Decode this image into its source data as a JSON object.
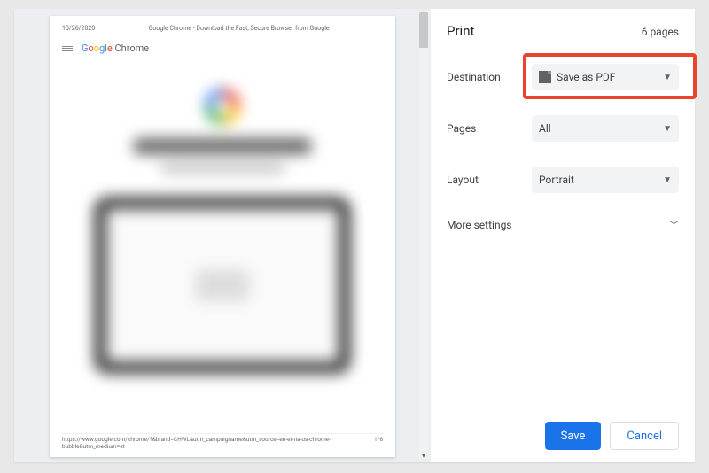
{
  "preview": {
    "date": "10/26/2020",
    "header_title": "Google Chrome - Download the Fast, Secure Browser from Google",
    "brand_prefix": "Google ",
    "brand_suffix": "Chrome",
    "footer_url": "https://www.google.com/chrome/?&brand=CHWL&utm_campaigname&utm_source=en-et-na-us-chrome-bubble&utm_medium=et",
    "footer_page": "1/6"
  },
  "panel": {
    "title": "Print",
    "page_count": "6 pages",
    "rows": {
      "destination": {
        "label": "Destination",
        "value": "Save as PDF"
      },
      "pages": {
        "label": "Pages",
        "value": "All"
      },
      "layout": {
        "label": "Layout",
        "value": "Portrait"
      }
    },
    "more_settings": "More settings",
    "buttons": {
      "save": "Save",
      "cancel": "Cancel"
    }
  }
}
